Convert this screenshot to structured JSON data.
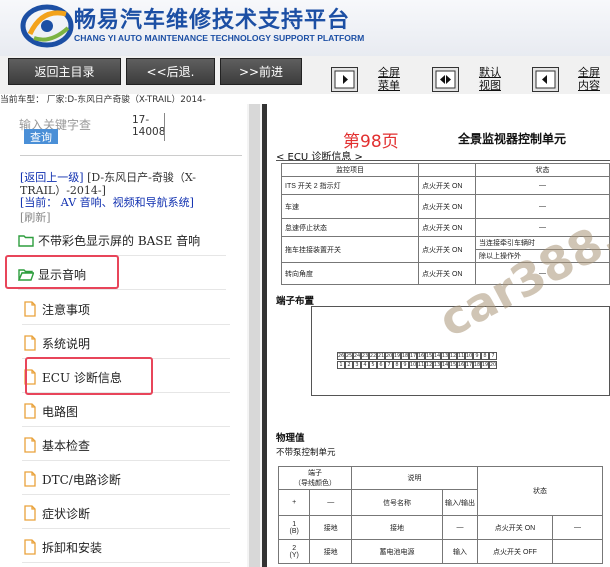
{
  "header": {
    "title": "畅易汽车维修技术支持平台",
    "subtitle": "CHANG YI AUTO MAINTENANCE TECHNOLOGY SUPPORT PLATFORM"
  },
  "toolbar": {
    "home": "返回主目录",
    "back": "<<后退.",
    "forward": ">>前进",
    "fullscreen_menu": [
      "全屏",
      "菜单"
    ],
    "default_view": [
      "默认",
      "视图"
    ],
    "fullscreen_content": [
      "全屏",
      "内容"
    ]
  },
  "vehicle_line": "当前车型：  厂家:D-东风日产奇骏（X-TRAIL）2014-",
  "search": {
    "placeholder": "输入关键字查",
    "button": "查询",
    "code": [
      "17-",
      "14008"
    ]
  },
  "nav": {
    "back_up": "[返回上一级]",
    "parent": "[D-东风日产-奇骏（X-TRAIL）-2014-]",
    "current_prefix": "[当前：",
    "current": "AV 音响、视频和导航系统]",
    "refresh": "[刷新]"
  },
  "tree": {
    "folders": [
      "不带彩色显示屏的 BASE 音响",
      "显示音响"
    ],
    "docs": [
      "注意事项",
      "系统说明",
      "ECU 诊断信息",
      "电路图",
      "基本检查",
      "DTC/电路诊断",
      "症状诊断",
      "拆卸和安装"
    ]
  },
  "document": {
    "page": "第98页",
    "title": "全景监视器控制单元",
    "section": "< ECU 诊断信息 >",
    "monitor_table": {
      "headers": [
        "监控项目",
        "状态"
      ],
      "rows": [
        [
          "ITS 开关 2 指示灯",
          "点火开关 ON",
          "—",
          ""
        ],
        [
          "车速",
          "点火开关 ON",
          "—",
          ""
        ],
        [
          "怠速停止状态",
          "点火开关 ON",
          "—",
          ""
        ],
        [
          "拖车挂接装置开关",
          "点火开关 ON",
          "当连接牵引车辆时",
          ""
        ],
        [
          "",
          "",
          "除以上操作外",
          ""
        ],
        [
          "转向角度",
          "点火开关 ON",
          "—",
          ""
        ]
      ]
    },
    "connector_heading": "端子布置",
    "connector_pins_top": [
      "26",
      "25",
      "24",
      "23",
      "22",
      "21",
      "20",
      "19",
      "18",
      "17",
      "16",
      "15",
      "14",
      "13",
      "12",
      "11",
      "10",
      "9",
      "8",
      "7"
    ],
    "connector_pins_bottom": [
      "1",
      "2",
      "3",
      "4",
      "5",
      "6",
      "7",
      "8",
      "9",
      "10",
      "11",
      "12",
      "13",
      "14",
      "15",
      "16",
      "17",
      "18",
      "19",
      "20"
    ],
    "physical_heading": "物理值",
    "pump_heading": "不带泵控制单元",
    "terminal_table": {
      "h_terminal": "端子",
      "h_wire": "（导线颜色）",
      "h_desc": "说明",
      "h_state": "状态",
      "h_plus": "+",
      "h_minus": "—",
      "h_signal": "信号名称",
      "h_io": "输入/输出",
      "rows": [
        {
          "pin": "1",
          "color": "(B)",
          "minus": "接地",
          "signal": "接地",
          "io": "—",
          "cond": "点火开关 ON",
          "val": "—"
        },
        {
          "pin": "2",
          "color": "(Y)",
          "minus": "接地",
          "signal": "蓄电池电源",
          "io": "输入",
          "cond": "点火开关 OFF",
          "val": ""
        }
      ]
    },
    "watermark": "car388.com"
  }
}
